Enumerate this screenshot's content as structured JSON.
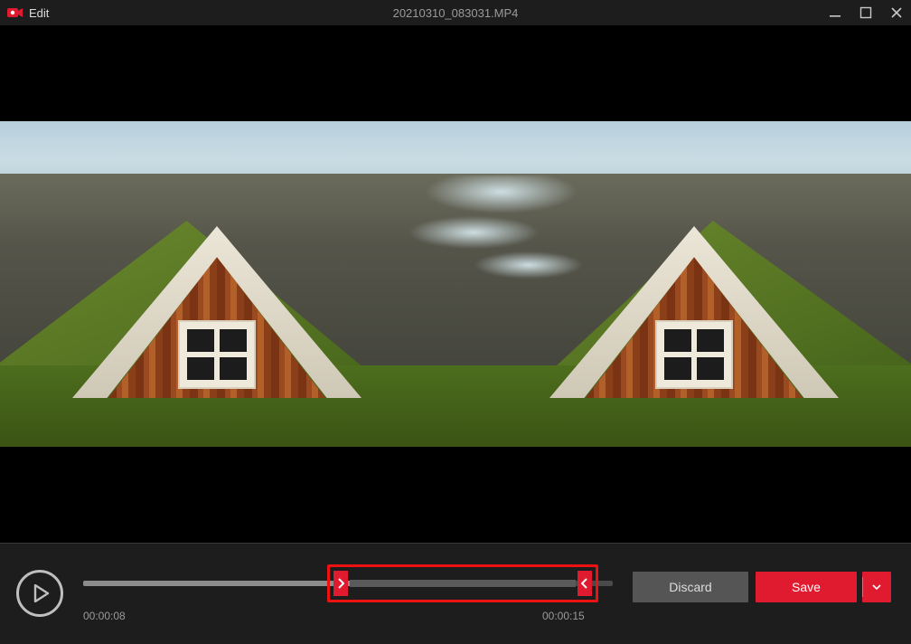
{
  "titlebar": {
    "app_label": "Edit",
    "filename": "20210310_083031.MP4"
  },
  "player": {
    "current_time": "00:00:08",
    "total_time": "00:00:15",
    "progress_percent": 52
  },
  "actions": {
    "discard_label": "Discard",
    "save_label": "Save"
  },
  "colors": {
    "accent": "#e01b2f",
    "panel": "#1d1d1d"
  }
}
